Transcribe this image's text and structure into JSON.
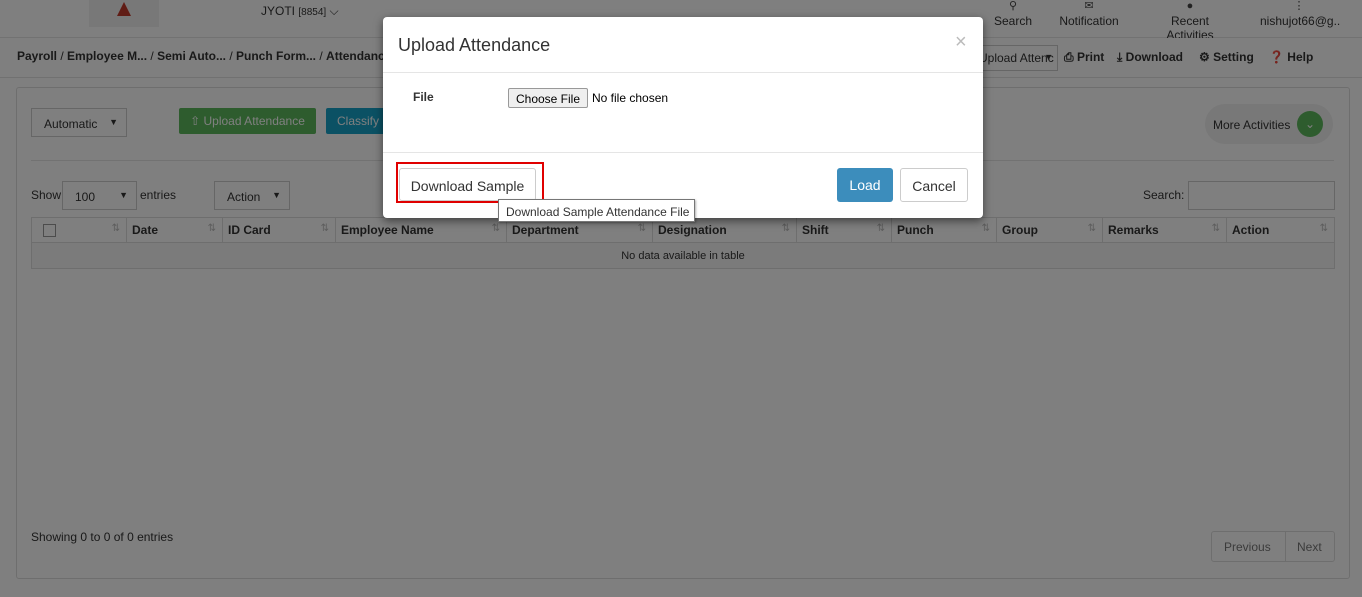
{
  "header": {
    "user_name": "JYOTI",
    "user_code": "[8854]",
    "search_label": "Search",
    "notification_label": "Notification",
    "recent_label": "Recent Activities",
    "account_label": "nishujot66@g..",
    "brand_color": "#c0392b"
  },
  "breadcrumb": {
    "items": [
      "Payroll",
      "Employee M...",
      "Semi Auto...",
      "Punch Form...",
      "Attendance"
    ]
  },
  "toolbar": {
    "action_select_value": "Upload Attenc",
    "print_label": "Print",
    "download_label": "Download",
    "setting_label": "Setting",
    "help_label": "Help"
  },
  "content": {
    "mode_select_value": "Automatic",
    "upload_button_label": "Upload Attendance",
    "classify_button_label": "Classify",
    "more_activities_label": "More Activities",
    "show_label": "Show",
    "entries_value": "100",
    "entries_label": "entries",
    "action_select_value": "Action",
    "search_label": "Search:",
    "search_value": "",
    "accent_green": "#5cb85c",
    "accent_blue": "#17a2c8"
  },
  "table": {
    "columns": [
      "Date",
      "ID Card",
      "Employee Name",
      "Department",
      "Designation",
      "Shift",
      "Punch",
      "Group",
      "Remarks",
      "Action"
    ],
    "empty_message": "No data available in table"
  },
  "footer": {
    "info": "Showing 0 to 0 of 0 entries",
    "previous_label": "Previous",
    "next_label": "Next"
  },
  "modal": {
    "title": "Upload Attendance",
    "close_glyph": "×",
    "file_label": "File",
    "choose_file_label": "Choose File",
    "no_file_text": "No file chosen",
    "download_sample_label": "Download Sample",
    "load_label": "Load",
    "cancel_label": "Cancel",
    "load_color": "#3c8dbc",
    "highlight_color": "#e00000"
  },
  "tooltip": {
    "text": "Download Sample Attendance File"
  }
}
